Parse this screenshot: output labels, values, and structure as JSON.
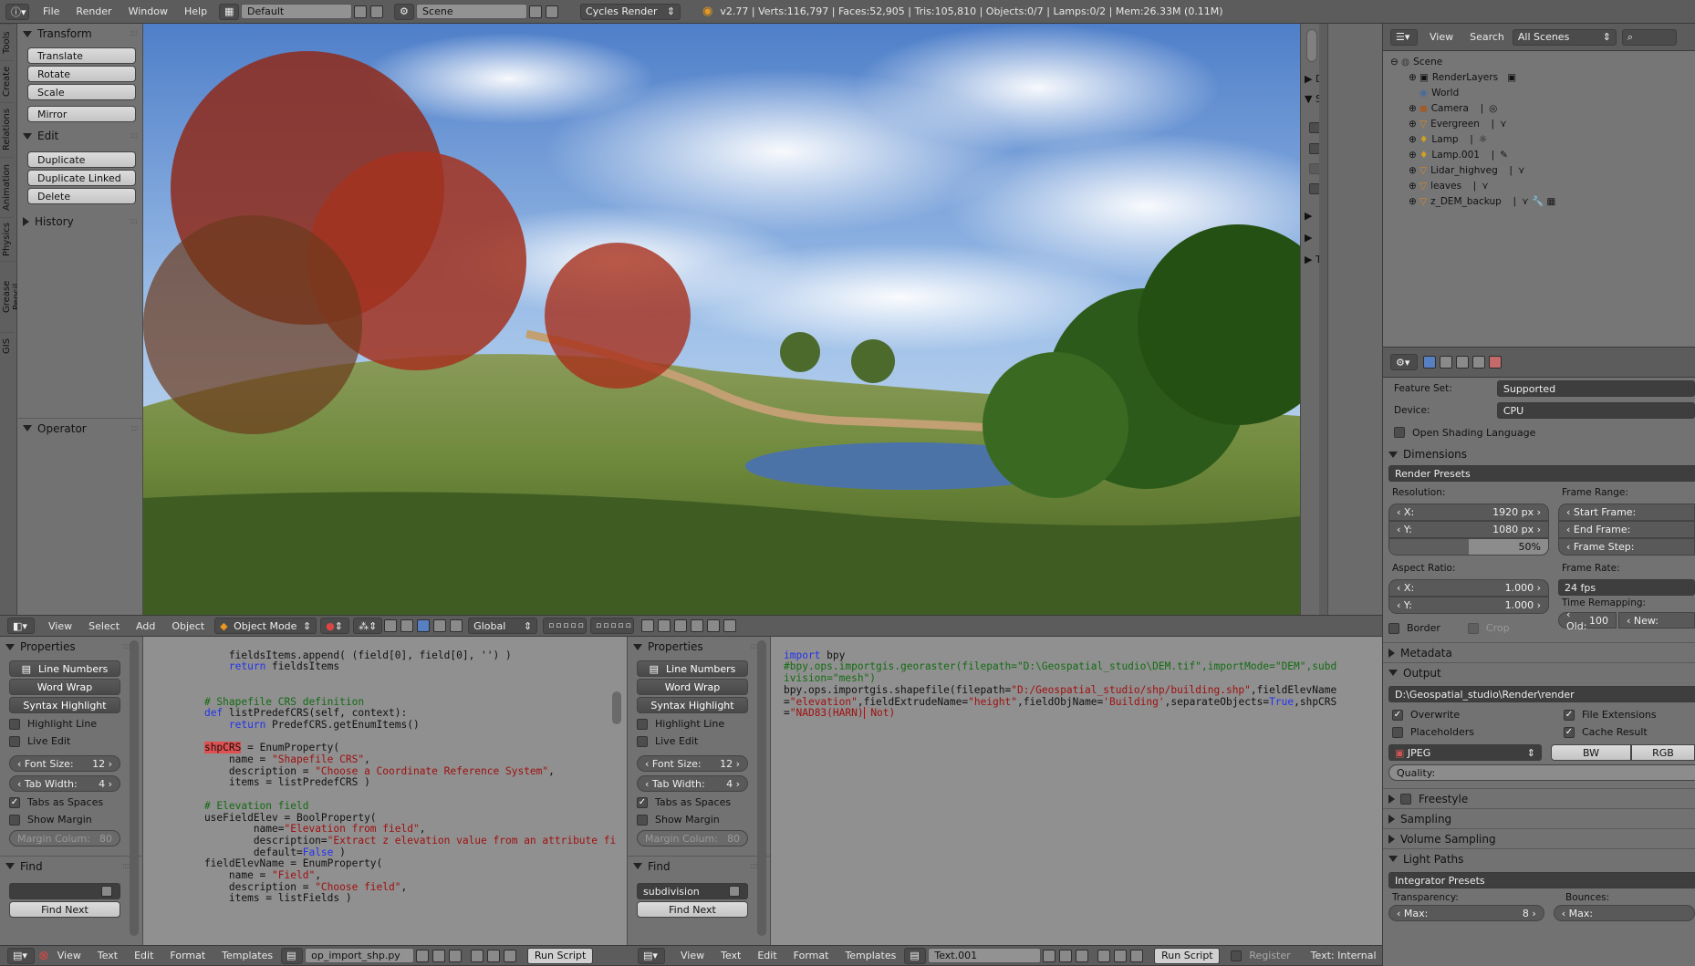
{
  "topbar": {
    "menus": [
      "File",
      "Render",
      "Window",
      "Help"
    ],
    "layout": "Default",
    "scene": "Scene",
    "engine": "Cycles Render",
    "stats": "v2.77 | Verts:116,797 | Faces:52,905 | Tris:105,810 | Objects:0/7 | Lamps:0/2 | Mem:26.33M (0.11M)"
  },
  "tool_shelf": {
    "tabs": [
      "Tools",
      "Create",
      "Relations",
      "Animation",
      "Physics",
      "Grease Pencil",
      "GIS"
    ],
    "transform": {
      "title": "Transform",
      "buttons": [
        "Translate",
        "Rotate",
        "Scale",
        "Mirror"
      ]
    },
    "edit": {
      "title": "Edit",
      "buttons": [
        "Duplicate",
        "Duplicate Linked",
        "Delete"
      ]
    },
    "history": {
      "title": "History"
    },
    "operator": {
      "title": "Operator"
    }
  },
  "viewport_side": {
    "labels": [
      "Di",
      "S",
      "Tr"
    ]
  },
  "viewport_header": {
    "menus": [
      "View",
      "Select",
      "Add",
      "Object"
    ],
    "mode": "Object Mode",
    "orientation": "Global"
  },
  "text_props_left": {
    "title": "Properties",
    "buttons": [
      "Line Numbers",
      "Word Wrap",
      "Syntax Highlight"
    ],
    "checks": [
      {
        "label": "Highlight Line",
        "on": false
      },
      {
        "label": "Live Edit",
        "on": false
      }
    ],
    "font_size_label": "Font Size:",
    "font_size": "12",
    "tab_width_label": "Tab Width:",
    "tab_width": "4",
    "tabs_spaces": "Tabs as Spaces",
    "show_margin": "Show Margin",
    "margin_label": "Margin Colum:",
    "margin": "80",
    "find_title": "Find",
    "find_value": "",
    "find_next": "Find Next"
  },
  "text_props_right": {
    "title": "Properties",
    "buttons": [
      "Line Numbers",
      "Word Wrap",
      "Syntax Highlight"
    ],
    "checks": [
      {
        "label": "Highlight Line",
        "on": false
      },
      {
        "label": "Live Edit",
        "on": false
      }
    ],
    "font_size_label": "Font Size:",
    "font_size": "12",
    "tab_width_label": "Tab Width:",
    "tab_width": "4",
    "tabs_spaces": "Tabs as Spaces",
    "show_margin": "Show Margin",
    "margin_label": "Margin Colum:",
    "margin": "80",
    "find_title": "Find",
    "find_value": "subdivision",
    "find_next": "Find Next"
  },
  "code_left": {
    "l1": "        fieldsItems.append( (field[0], field[0], '') )",
    "l2a": "        ",
    "l2b": "return",
    " l2c": " fieldsItems",
    "l3": "    # Shapefile CRS definition",
    "l4a": "    ",
    "l4b": "def",
    " l4c": " listPredefCRS(self, context):",
    "l5a": "        ",
    "l5b": "return",
    " l5c": " PredefCRS.getEnumItems()",
    "l6a": "shpCRS",
    "l6b": " = EnumProperty(",
    "l7a": "        name = ",
    "l7b": "\"Shapefile CRS\"",
    "l7c": ",",
    "l8a": "        description = ",
    "l8b": "\"Choose a Coordinate Reference System\"",
    "l8c": ",",
    "l9": "        items = listPredefCRS )",
    "l10": "    # Elevation field",
    "l11": "    useFieldElev = BoolProperty(",
    "l12a": "            name=",
    "l12b": "\"Elevation from field\"",
    "l12c": ",",
    "l13a": "            description=",
    "l13b": "\"Extract z elevation value from an attribute fi",
    "l14a": "            default=",
    "l14b": "False",
    " l14c": " )",
    "l15": "    fieldElevName = EnumProperty(",
    "l16a": "        name = ",
    "l16b": "\"Field\"",
    "l16c": ",",
    "l17a": "        description = ",
    "l17b": "\"Choose field\"",
    "l17c": ",",
    "l18": "        items = listFields )"
  },
  "code_right": {
    "r1a": "import",
    "r1b": " bpy",
    "r2": "#bpy.ops.importgis.georaster(filepath=\"D:\\Geospatial_studio\\DEM.tif\",importMode=\"DEM\",subd",
    "r3": "ivision=\"mesh\")",
    "r4a": "bpy.ops.importgis.shapefile(filepath=",
    "r4b": "\"D:/Geospatial_studio/shp/building.shp\"",
    "r4c": ",fieldElevName",
    "r5a": "=",
    "r5b": "\"elevation\"",
    "r5c": ",fieldExtrudeName=",
    "r5d": "\"height\"",
    "r5e": ",fieldObjName=",
    "r5f": "'Building'",
    "r5g": ",separateObjects=",
    "r5h": "True",
    "r5i": ",shpCRS",
    "r6a": "=",
    "r6b": "\"NAD83(HARN)",
    "r6c": " Not)"
  },
  "text_footer_left": {
    "menus": [
      "View",
      "Text",
      "Edit",
      "Format",
      "Templates"
    ],
    "filename": "op_import_shp.py",
    "run": "Run Script"
  },
  "text_footer_right": {
    "menus": [
      "View",
      "Text",
      "Edit",
      "Format",
      "Templates"
    ],
    "filename": "Text.001",
    "run": "Run Script",
    "register": "Register",
    "internal": "Text: Internal"
  },
  "outliner": {
    "menus": [
      "View",
      "Search"
    ],
    "filter": "All Scenes",
    "items": [
      "Scene",
      "RenderLayers",
      "World",
      "Camera",
      "Evergreen",
      "Lamp",
      "Lamp.001",
      "Lidar_highveg",
      "leaves",
      "z_DEM_backup"
    ]
  },
  "render_props": {
    "feature_set_label": "Feature Set:",
    "feature_set": "Supported",
    "device_label": "Device:",
    "device": "CPU",
    "osl": "Open Shading Language",
    "dimensions": "Dimensions",
    "render_presets": "Render Presets",
    "resolution": "Resolution:",
    "res_x_label": "X:",
    "res_x": "1920 px",
    "res_y_label": "Y:",
    "res_y": "1080 px",
    "res_pct": "50%",
    "res_pct_value": 0.5,
    "frame_range": "Frame Range:",
    "start_frame": "Start Frame:",
    "end_frame": "End Frame:",
    "frame_step": "Frame Step:",
    "aspect": "Aspect Ratio:",
    "asp_x_label": "X:",
    "asp_x": "1.000",
    "asp_y_label": "Y:",
    "asp_y": "1.000",
    "frame_rate": "Frame Rate:",
    "fps": "24 fps",
    "time_remap": "Time Remapping:",
    "old_label": "Old:",
    "old": "100",
    "new_label": "New:",
    "border": "Border",
    "crop": "Crop",
    "metadata": "Metadata",
    "output": "Output",
    "output_path": "D:\\Geospatial_studio\\Render\\render",
    "overwrite": "Overwrite",
    "file_ext": "File Extensions",
    "placeholders": "Placeholders",
    "cache_result": "Cache Result",
    "format": "JPEG",
    "bw": "BW",
    "rgb": "RGB",
    "quality": "Quality:",
    "freestyle": "Freestyle",
    "sampling": "Sampling",
    "volume_sampling": "Volume Sampling",
    "light_paths": "Light Paths",
    "integrator": "Integrator Presets",
    "transparency": "Transparency:",
    "max_label": "Max:",
    "max": "8",
    "bounces": "Bounces:",
    "bmax_label": "Max:"
  }
}
